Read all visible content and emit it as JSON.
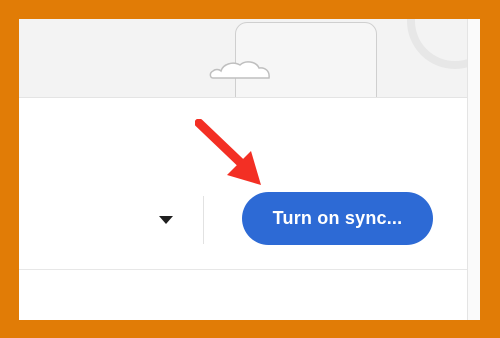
{
  "colors": {
    "frame_border": "#e17c06",
    "button_background": "#2d6ad5",
    "button_text": "#ffffff",
    "arrow": "#f32f24",
    "caret": "#1f1f1f"
  },
  "icons": {
    "cloud": "cloud-icon",
    "pointer_arrow": "arrow-icon",
    "dropdown": "caret-down-icon"
  },
  "toolbar": {
    "sync_button_label": "Turn on sync..."
  }
}
